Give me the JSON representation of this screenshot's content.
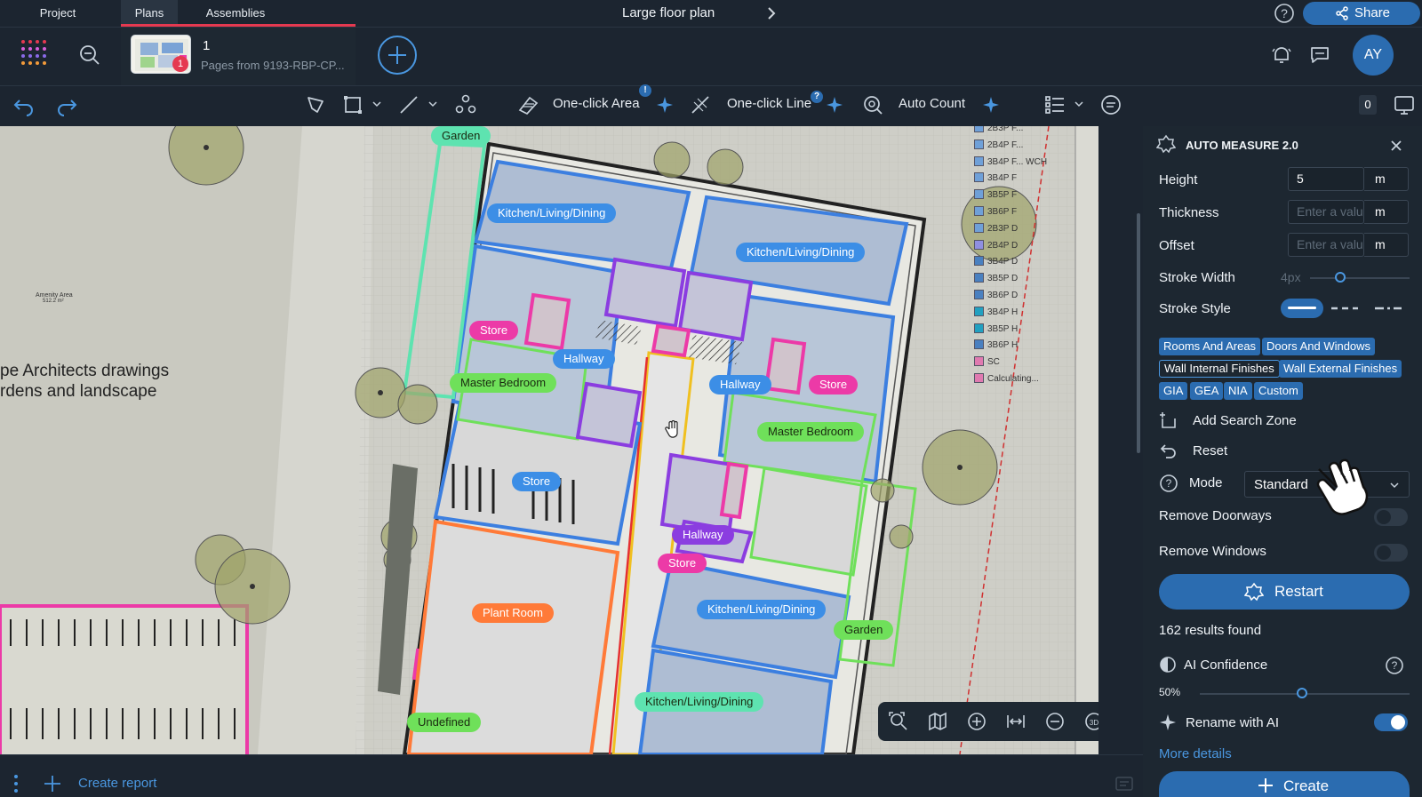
{
  "topbar": {
    "tabs": [
      {
        "label": "Project"
      },
      {
        "label": "Plans"
      },
      {
        "label": "Assemblies"
      }
    ],
    "doc_title": "Large floor plan",
    "share_label": "Share"
  },
  "plan": {
    "number": "1",
    "subtitle": "Pages from 9193-RBP-CP...",
    "badge": "1"
  },
  "user": {
    "initials": "AY"
  },
  "toolbar": {
    "one_click_area": "One-click Area",
    "one_click_line": "One-click Line",
    "auto_count": "Auto Count",
    "area_badge": "!",
    "line_badge": "?",
    "count": "0"
  },
  "drawing": {
    "text_line1": "pe Architects drawings",
    "text_line2": "rdens and landscape",
    "amenity_area": "Amenity Area",
    "amenity_size": "512.2 m²",
    "room_labels": [
      {
        "text": "Garden",
        "color": "#5ee3b0"
      },
      {
        "text": "Kitchen/Living/Dining",
        "color": "#3c8ee6"
      },
      {
        "text": "Kitchen/Living/Dining",
        "color": "#3c8ee6"
      },
      {
        "text": "Store",
        "color": "#ec3aa7"
      },
      {
        "text": "Hallway",
        "color": "#3c8ee6"
      },
      {
        "text": "Master Bedroom",
        "color": "#6fe05a"
      },
      {
        "text": "Hallway",
        "color": "#3c8ee6"
      },
      {
        "text": "Store",
        "color": "#ec3aa7"
      },
      {
        "text": "Master Bedroom",
        "color": "#6fe05a"
      },
      {
        "text": "Store",
        "color": "#3c8ee6"
      },
      {
        "text": "Hallway",
        "color": "#8b3de0"
      },
      {
        "text": "Store",
        "color": "#ec3aa7"
      },
      {
        "text": "Plant Room",
        "color": "#ff7a38"
      },
      {
        "text": "Kitchen/Living/Dining",
        "color": "#3c8ee6"
      },
      {
        "text": "Garden",
        "color": "#6fe05a"
      },
      {
        "text": "Kitchen/Living/Dining",
        "color": "#5ee3b0"
      },
      {
        "text": "Undefined",
        "color": "#6fe05a"
      }
    ],
    "legend": [
      {
        "label": "2B3P F...",
        "color": "#6fa0d8"
      },
      {
        "label": "2B4P F...",
        "color": "#6fa0d8"
      },
      {
        "label": "3B4P F... WCH",
        "color": "#6fa0d8"
      },
      {
        "label": "3B4P F",
        "color": "#6fa0d8"
      },
      {
        "label": "3B5P F",
        "color": "#6fa0d8"
      },
      {
        "label": "3B6P F",
        "color": "#6fa0d8"
      },
      {
        "label": "2B3P D",
        "color": "#6fa0d8"
      },
      {
        "label": "2B4P D",
        "color": "#8f8fe0"
      },
      {
        "label": "3B4P D",
        "color": "#4a80c0"
      },
      {
        "label": "3B5P D",
        "color": "#4a80c0"
      },
      {
        "label": "3B6P D",
        "color": "#4a80c0"
      },
      {
        "label": "3B4P H",
        "color": "#22a0c0"
      },
      {
        "label": "3B5P H",
        "color": "#22a0c0"
      },
      {
        "label": "3B6P H",
        "color": "#4a80c0"
      },
      {
        "label": "SC",
        "color": "#e07ab0"
      },
      {
        "label": "Calculating...",
        "color": "#e07ab0"
      }
    ]
  },
  "panel": {
    "title": "AUTO MEASURE 2.0",
    "height_label": "Height",
    "height_value": "5",
    "thickness_label": "Thickness",
    "offset_label": "Offset",
    "enter_placeholder": "Enter a valu",
    "unit": "m",
    "stroke_width_label": "Stroke Width",
    "stroke_width_value": "4px",
    "stroke_style_label": "Stroke Style",
    "chips": [
      {
        "label": "Rooms And Areas",
        "selected": true
      },
      {
        "label": "Doors And Windows",
        "selected": true
      },
      {
        "label": "Wall Internal Finishes",
        "selected": false
      },
      {
        "label": "Wall External Finishes",
        "selected": true
      },
      {
        "label": "GIA",
        "selected": true
      },
      {
        "label": "GEA",
        "selected": true
      },
      {
        "label": "NIA",
        "selected": true
      },
      {
        "label": "Custom",
        "selected": true
      }
    ],
    "add_search_zone": "Add Search Zone",
    "reset": "Reset",
    "mode_label": "Mode",
    "mode_value": "Standard",
    "remove_doorways": "Remove Doorways",
    "remove_doorways_on": false,
    "remove_windows": "Remove Windows",
    "remove_windows_on": false,
    "restart": "Restart",
    "results": "162 results found",
    "ai_confidence": "AI Confidence",
    "ai_confidence_value": "50%",
    "rename_with_ai": "Rename with AI",
    "rename_with_ai_on": true,
    "more_details": "More details",
    "create": "Create"
  },
  "bottombar": {
    "create_report": "Create report"
  },
  "colors": {
    "accent": "#2b6cb0",
    "danger": "#e53950",
    "bg": "#1c2530",
    "panel": "#1d2731"
  }
}
